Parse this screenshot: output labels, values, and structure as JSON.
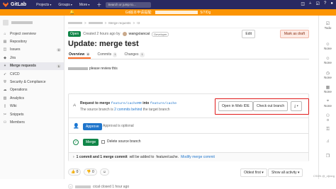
{
  "topbar": {
    "brand": "GitLab",
    "nav": [
      "Projects",
      "Groups",
      "More"
    ],
    "search_placeholder": "Search or jump to...",
    "plus_icon": "plus-icon"
  },
  "banner": {
    "text_prefix": "Git版本申请提醒: ",
    "text_suffix": "5/7/Dg"
  },
  "sidebar": {
    "items": [
      {
        "label": "Project overview",
        "icon": "home-icon"
      },
      {
        "label": "Repository",
        "icon": "doc-icon"
      },
      {
        "label": "Issues",
        "icon": "issues-icon",
        "count": "0"
      },
      {
        "label": "Jira",
        "icon": "jira-icon"
      },
      {
        "label": "Merge requests",
        "icon": "merge-request-icon",
        "count": "1"
      },
      {
        "label": "CI/CD",
        "icon": "rocket-icon"
      },
      {
        "label": "Security & Compliance",
        "icon": "shield-icon"
      },
      {
        "label": "Operations",
        "icon": "cloud-icon"
      },
      {
        "label": "Analytics",
        "icon": "chart-icon"
      },
      {
        "label": "Wiki",
        "icon": "book-icon"
      },
      {
        "label": "Snippets",
        "icon": "snippet-icon"
      },
      {
        "label": "Members",
        "icon": "users-icon"
      }
    ]
  },
  "breadcrumb": {
    "sep": ">",
    "current": "Merge requests",
    "id": "!3"
  },
  "mr": {
    "state": "Open",
    "created": "Created 2 hours ago by",
    "author": "wangxiancai",
    "role": "Developer",
    "edit": "Edit",
    "mark_draft": "Mark as draft",
    "title": "Update: merge test",
    "tabs": [
      {
        "label": "Overview",
        "count": "0"
      },
      {
        "label": "Commits",
        "count": "1"
      },
      {
        "label": "Changes",
        "count": "1"
      }
    ],
    "description": "please review this",
    "merge_info": {
      "prefix": "Request to merge",
      "source": "feature/cacheMR",
      "mid": "into",
      "target": "feature/cache",
      "behind_prefix": "The source branch is",
      "behind_link": "2 commits behind",
      "behind_suffix": "the target branch"
    },
    "open_web_ide": "Open in Web IDE",
    "checkout": "Check out branch",
    "download_icon": "download-icon",
    "approve": "Approve",
    "approval_optional": "Approval is optional",
    "merge": "Merge",
    "delete_source": "Delete source branch",
    "commit_summary": {
      "bold": "1 commit and 1 merge commit",
      "rest": "will be added to",
      "branch": "feature/cache.",
      "link": "Modify merge commit"
    },
    "thumbs_up": "0",
    "thumbs_down": "0",
    "sort": "Oldest first",
    "filter": "Show all activity",
    "activity": "cical closed 1 hour ago"
  },
  "right_sidebar": [
    {
      "label": "Todo",
      "icon": "checkbox-icon"
    },
    {
      "label": "None",
      "icon": "user-icon"
    },
    {
      "label": "None",
      "icon": "user-icon"
    },
    {
      "label": "None",
      "icon": "clock-icon"
    },
    {
      "label": "None",
      "icon": "calendar-icon"
    },
    {
      "label": "None",
      "icon": "label-icon"
    },
    {
      "label": "0",
      "icon": "users-icon"
    },
    {
      "label": "",
      "icon": "lock-icon"
    },
    {
      "label": "",
      "icon": "bell-icon"
    },
    {
      "label": "",
      "icon": "copy-icon"
    }
  ],
  "watermark": "CSDN @_cijiang"
}
